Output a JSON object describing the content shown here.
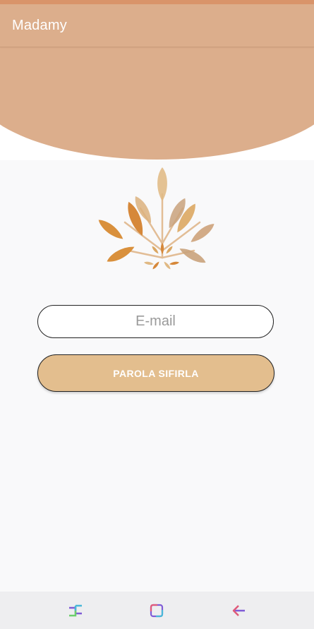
{
  "app": {
    "title": "Madamy"
  },
  "form": {
    "email_placeholder": "E-mail",
    "email_value": "",
    "reset_button_label": "PAROLA SIFIRLA"
  },
  "icons": {
    "logo": "autumn-leaf-tree-icon",
    "nav_recents": "recents-icon",
    "nav_home": "home-icon",
    "nav_back": "back-arrow-icon"
  },
  "colors": {
    "status_bar": "#d9946a",
    "header": "#dcae8c",
    "background": "#f9f9fa",
    "button": "#e3be8e",
    "button_text": "#ffffff",
    "nav_bar": "#eeeef0"
  }
}
